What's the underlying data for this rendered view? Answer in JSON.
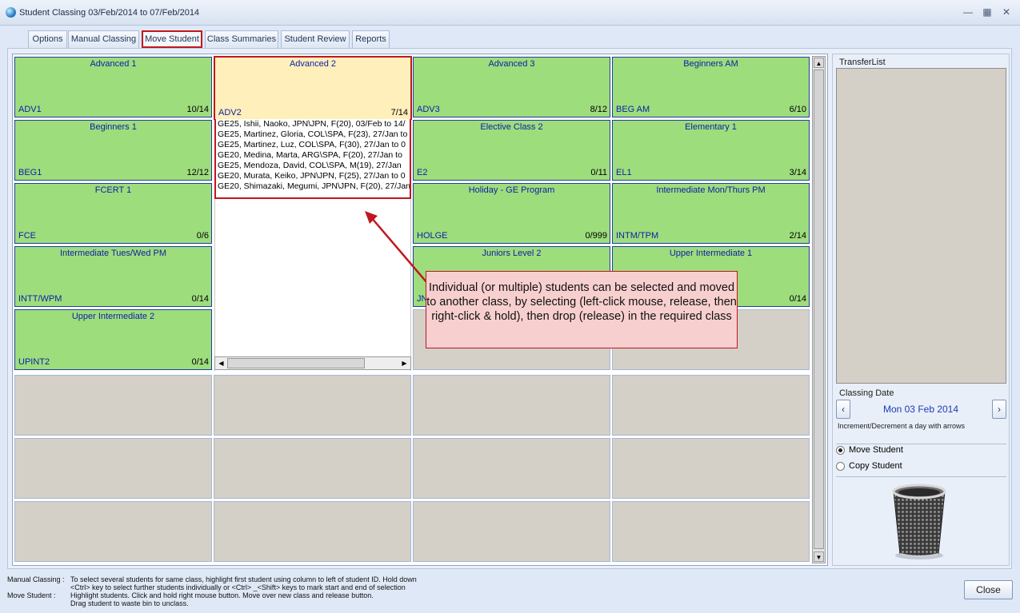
{
  "window": {
    "title": "Student Classing   03/Feb/2014 to 07/Feb/2014"
  },
  "tabs": [
    {
      "label": "Options"
    },
    {
      "label": "Manual Classing"
    },
    {
      "label": "Move Student",
      "active": true
    },
    {
      "label": "Class Summaries"
    },
    {
      "label": "Student Review"
    },
    {
      "label": "Reports"
    }
  ],
  "classes": [
    {
      "name": "Advanced 1",
      "code": "ADV1",
      "count": "10/14"
    },
    {
      "name": "Advanced 2",
      "code": "ADV2",
      "count": "7/14"
    },
    {
      "name": "Advanced 3",
      "code": "ADV3",
      "count": "8/12"
    },
    {
      "name": "Beginners AM",
      "code": "BEG AM",
      "count": "6/10"
    },
    {
      "name": "Beginners 1",
      "code": "BEG1",
      "count": "12/12"
    },
    {
      "name": "Elective Class 2",
      "code": "E2",
      "count": "0/11"
    },
    {
      "name": "Elementary 1",
      "code": "EL1",
      "count": "3/14"
    },
    {
      "name": "FCERT 1",
      "code": "FCE",
      "count": "0/6"
    },
    {
      "name": "Holiday - GE Program",
      "code": "HOLGE",
      "count": "0/999"
    },
    {
      "name": "Intermediate Mon/Thurs PM",
      "code": "INTM/TPM",
      "count": "2/14"
    },
    {
      "name": "Intermediate Tues/Wed PM",
      "code": "INTT/WPM",
      "count": "0/14"
    },
    {
      "name": "Juniors Level 2",
      "code": "JN",
      "count": ""
    },
    {
      "name": "Upper Intermediate 1",
      "code": "",
      "count": "0/14"
    },
    {
      "name": "Upper Intermediate 2",
      "code": "UPINT2",
      "count": "0/14"
    }
  ],
  "students": [
    "GE25, Ishii, Naoko, JPN\\JPN, F(20), 03/Feb to 14/",
    "GE25, Martinez, Gloria, COL\\SPA, F(23), 27/Jan to",
    "GE25, Martinez, Luz, COL\\SPA, F(30), 27/Jan to 0",
    "GE20, Medina, Marta, ARG\\SPA, F(20), 27/Jan to",
    "GE25, Mendoza, David, COL\\SPA, M(19), 27/Jan",
    "GE20, Murata, Keiko, JPN\\JPN, F(25), 27/Jan to 0",
    "GE20, Shimazaki, Megumi, JPN\\JPN, F(20), 27/Jan"
  ],
  "callout": {
    "text": "Individual (or multiple) students can be selected and moved to another class, by selecting (left-click mouse, release, then right-click & hold), then drop (release) in the required class"
  },
  "right_panel": {
    "transfer_label": "TransferList",
    "classing_date_label": "Classing Date",
    "date_value": "Mon 03 Feb 2014",
    "date_hint": "Increment/Decrement a day with arrows",
    "options": [
      {
        "label": "Move Student",
        "selected": true
      },
      {
        "label": "Copy Student",
        "selected": false
      }
    ]
  },
  "footer": {
    "manual_label": "Manual Classing :",
    "move_label": "Move Student :",
    "lines": [
      "To select several students for same class, highlight first student using column to left of student ID. Hold down",
      "<Ctrl>  key to select further students individually or <Ctrl>  _<Shift>  keys to mark start and end of selection",
      "Highlight students. Click and hold right mouse button. Move over new class and release button.",
      "Drag student to waste bin to unclass."
    ]
  },
  "buttons": {
    "close": "Close"
  },
  "colors": {
    "class_green": "#9edd7c",
    "selected_class": "#ffefbb",
    "highlight_red": "#c0171e",
    "link_blue": "#0c1fa8"
  }
}
